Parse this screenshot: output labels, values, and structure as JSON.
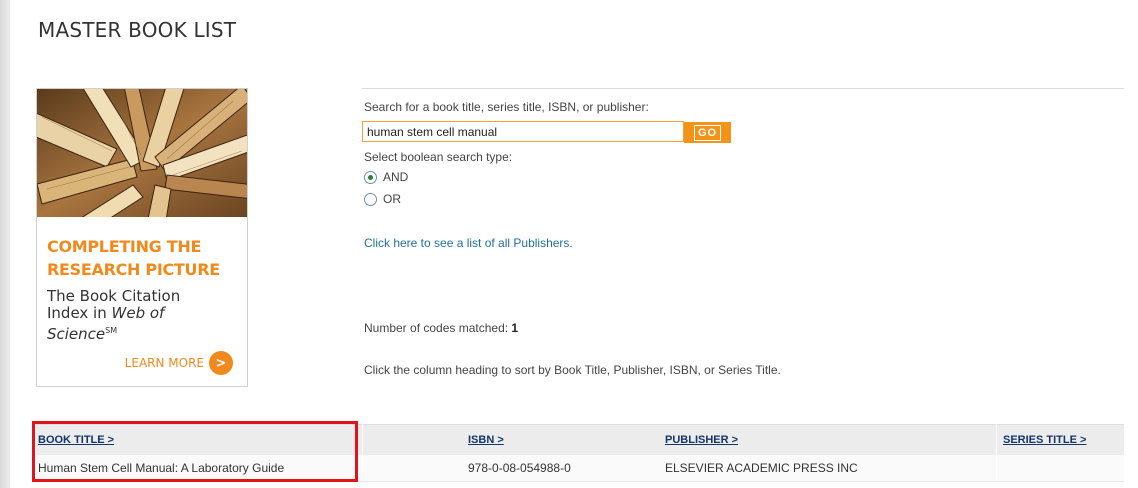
{
  "page": {
    "title": "MASTER BOOK LIST"
  },
  "ad": {
    "headline_line1": "COMPLETING THE",
    "headline_line2": "RESEARCH PICTURE",
    "body_line1": "The Book Citation",
    "body_line2_prefix": "Index in ",
    "body_line2_italic": "Web of",
    "body_line3_italic": "Science",
    "body_line3_sup": "SM",
    "cta_label": "LEARN MORE",
    "cta_icon": ">",
    "accent_color": "#f08a1d"
  },
  "search": {
    "label": "Search for a book title, series title, ISBN, or publisher:",
    "value": "human stem cell manual",
    "go_label": "GO",
    "boolean_label": "Select boolean search type:",
    "options": [
      {
        "label": "AND",
        "checked": true
      },
      {
        "label": "OR",
        "checked": false
      }
    ],
    "publishers_link": "Click here to see a list of all Publishers.",
    "matched_label": "Number of codes matched:",
    "matched_count": "1",
    "sort_hint": "Click the column heading to sort by Book Title, Publisher, ISBN, or Series Title."
  },
  "results": {
    "columns": [
      "BOOK TITLE >",
      "ISBN >",
      "PUBLISHER >",
      "SERIES TITLE >"
    ],
    "rows": [
      {
        "book_title": "Human Stem Cell Manual: A Laboratory Guide",
        "isbn": "978-0-08-054988-0",
        "publisher": "ELSEVIER ACADEMIC PRESS INC",
        "series_title": ""
      }
    ]
  },
  "colors": {
    "go_button": "#f39418",
    "link": "#1f6f9a",
    "header_link": "#12356b",
    "highlight": "#e0141b"
  }
}
